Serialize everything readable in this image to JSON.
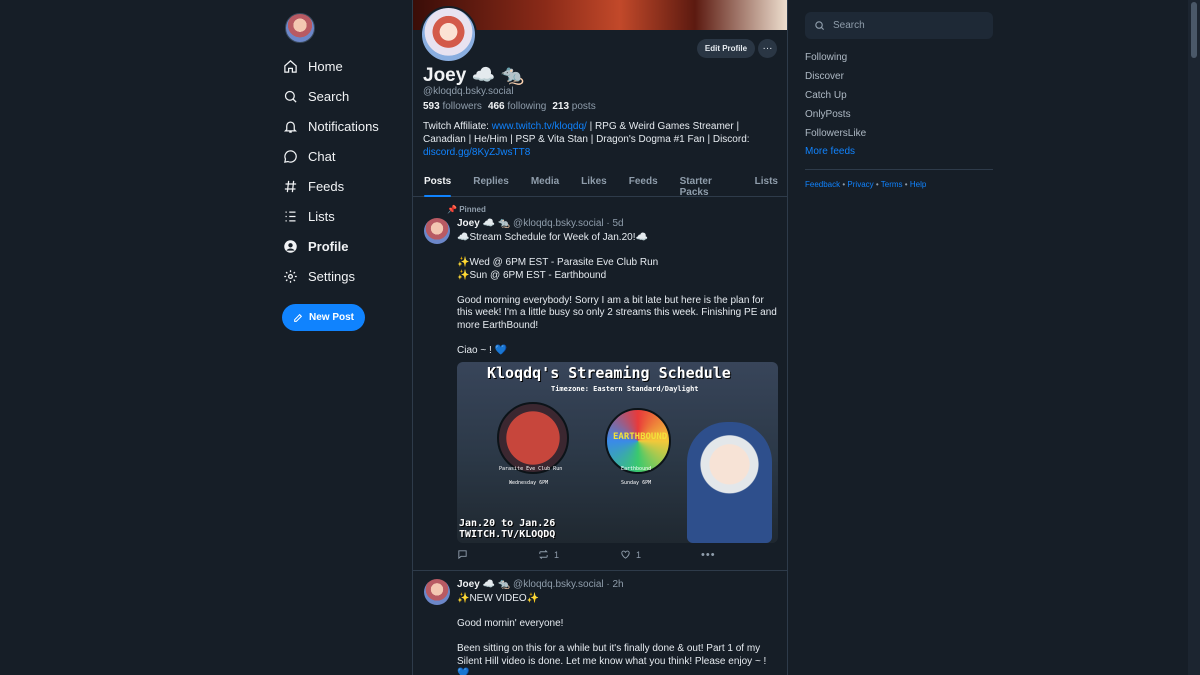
{
  "nav": {
    "items": [
      {
        "label": "Home",
        "icon": "home-icon"
      },
      {
        "label": "Search",
        "icon": "search-icon"
      },
      {
        "label": "Notifications",
        "icon": "bell-icon"
      },
      {
        "label": "Chat",
        "icon": "chat-icon"
      },
      {
        "label": "Feeds",
        "icon": "hash-icon"
      },
      {
        "label": "Lists",
        "icon": "list-icon"
      },
      {
        "label": "Profile",
        "icon": "profile-icon"
      },
      {
        "label": "Settings",
        "icon": "gear-icon"
      }
    ],
    "active": "Profile",
    "new_post_label": "New Post"
  },
  "profile": {
    "edit_label": "Edit Profile",
    "more_label": "···",
    "display_name": "Joey ☁️ 🐀",
    "handle": "@kloqdq.bsky.social",
    "followers_count": "593",
    "followers_label": "followers",
    "following_count": "466",
    "following_label": "following",
    "posts_count": "213",
    "posts_label": "posts",
    "bio_prefix": "Twitch Affiliate: ",
    "bio_link1": "www.twitch.tv/kloqdq/",
    "bio_middle": " | RPG & Weird Games Streamer | Canadian | He/Him | PSP & Vita Stan | Dragon's Dogma #1 Fan | Discord: ",
    "bio_link2": "discord.gg/8KyZJwsTT8"
  },
  "tabs": [
    "Posts",
    "Replies",
    "Media",
    "Likes",
    "Feeds",
    "Starter Packs",
    "Lists"
  ],
  "active_tab": "Posts",
  "post1": {
    "pinned_label": "Pinned",
    "name": "Joey ☁️ 🐀",
    "handle": "@kloqdq.bsky.social",
    "time": "· 5d",
    "lines": [
      "☁️Stream Schedule for Week of Jan.20!☁️",
      "",
      "✨Wed @ 6PM EST - Parasite Eve Club Run",
      "✨Sun @ 6PM EST - Earthbound",
      "",
      "Good morning everybody! Sorry I am a bit late but here is the plan for this week! I'm a little busy so only 2 streams this week. Finishing PE and more EarthBound!",
      "",
      "Ciao ~ ! 💙"
    ],
    "image": {
      "title": "Kloqdq's Streaming Schedule",
      "subtitle": "Timezone: Eastern Standard/Daylight",
      "game1": "Parasite Eve Club Run",
      "game1_time": "Wednesday 6PM",
      "game2": "Earthbound",
      "game2_time": "Sunday 6PM",
      "logo_text": "EARTHBOUND",
      "dates": "Jan.20 to Jan.26",
      "url": "TWITCH.TV/KLOQDQ"
    },
    "reposts": "1",
    "likes": "1"
  },
  "post2": {
    "name": "Joey ☁️ 🐀",
    "handle": "@kloqdq.bsky.social",
    "time": "· 2h",
    "lines": [
      "✨NEW VIDEO✨",
      "",
      "Good mornin' everyone!",
      "",
      "Been sitting on this for a while but it's finally done & out! Part 1 of my Silent Hill video is done. Let me know what you think! Please enjoy ~ !",
      "💙"
    ]
  },
  "right": {
    "search_placeholder": "Search",
    "feeds": [
      "Following",
      "Discover",
      "Catch Up",
      "OnlyPosts",
      "FollowersLike"
    ],
    "more_feeds": "More feeds",
    "footer": [
      "Feedback",
      "Privacy",
      "Terms",
      "Help"
    ]
  },
  "colors": {
    "background": "#161e27",
    "accent": "#1083fe",
    "muted": "#8f9dab",
    "border": "#2e3b4a"
  }
}
